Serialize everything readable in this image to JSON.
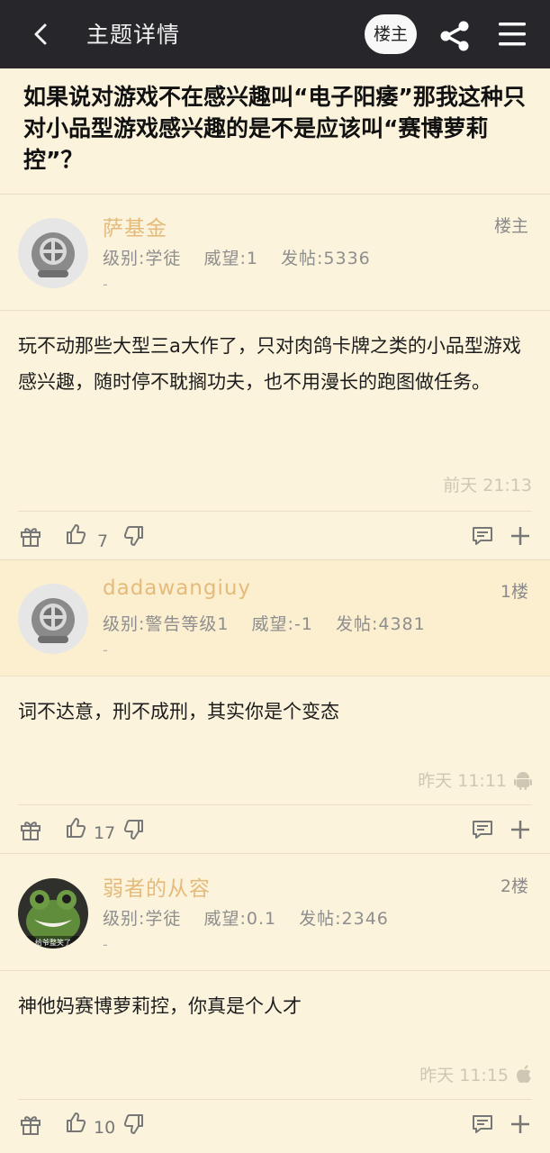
{
  "topbar": {
    "back_icon": "back-arrow-icon",
    "title": "主题详情",
    "op_button": "楼主",
    "share_icon": "share-icon",
    "menu_icon": "hamburger-menu-icon",
    "bg_color": "#27262b"
  },
  "thread": {
    "title": "如果说对游戏不在感兴趣叫“电子阳痿”那我这种只对小品型游戏感兴趣的是不是应该叫“赛博萝莉控”？"
  },
  "posts": [
    {
      "author": "萨基金",
      "floor": "楼主",
      "level": "级别:学徒",
      "prestige": "威望:1",
      "post_count": "发帖:5336",
      "signature": "-",
      "content": "玩不动那些大型三a大作了，只对肉鸽卡牌之类的小品型游戏感兴趣，随时停不耽搁功夫，也不用漫长的跑图做任务。",
      "time": "前天 21:13",
      "device_icon": "",
      "likes": "7"
    },
    {
      "author": "dadawangiuy",
      "floor": "1楼",
      "level": "级别:警告等级1",
      "prestige": "威望:-1",
      "post_count": "发帖:4381",
      "signature": "-",
      "content": "词不达意，刑不成刑，其实你是个变态",
      "time": "昨天 11:11",
      "device_icon": "android-icon",
      "likes": "17"
    },
    {
      "author": "弱者的从容",
      "floor": "2楼",
      "level": "级别:学徒",
      "prestige": "威望:0.1",
      "post_count": "发帖:2346",
      "signature": "-",
      "avatar_caption": "给爷整笑了",
      "content": "神他妈赛博萝莉控，你真是个人才",
      "time": "昨天 11:15",
      "device_icon": "apple-icon",
      "likes": "10"
    }
  ],
  "colors": {
    "background": "#fbf3dc",
    "highlight": "#fcefd0",
    "author": "#e4bb7a"
  }
}
